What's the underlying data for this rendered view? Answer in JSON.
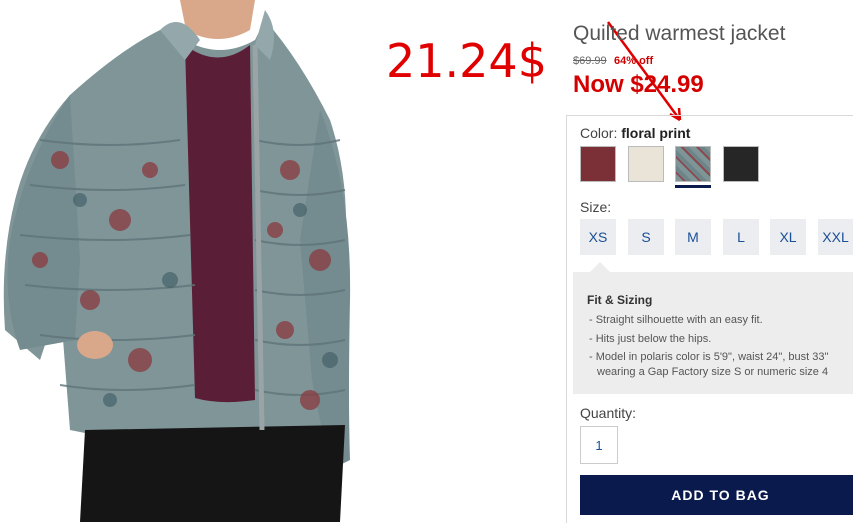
{
  "annotation": {
    "price_text": "21.24$",
    "color": "#e00000"
  },
  "product": {
    "title": "Quilted warmest jacket",
    "original_price": "$69.99",
    "discount": "64% off",
    "now_price": "Now $24.99"
  },
  "color": {
    "label": "Color:",
    "selected": "floral print",
    "swatches": [
      {
        "name": "burgundy",
        "hex": "#7a3036"
      },
      {
        "name": "cream",
        "hex": "#e9e3d8"
      },
      {
        "name": "floral print",
        "hex": "#7e9597"
      },
      {
        "name": "black",
        "hex": "#262626"
      }
    ]
  },
  "size": {
    "label": "Size:",
    "options": [
      "XS",
      "S",
      "M",
      "L",
      "XL",
      "XXL"
    ]
  },
  "fit": {
    "title": "Fit & Sizing",
    "lines": [
      "- Straight silhouette with an easy fit.",
      "- Hits just below the hips.",
      "- Model in polaris color is 5'9\", waist 24\", bust 33\"",
      "  wearing a Gap Factory size S or numeric size 4"
    ]
  },
  "quantity": {
    "label": "Quantity:",
    "value": "1"
  },
  "cart": {
    "button_label": "ADD TO BAG"
  },
  "colors": {
    "sale_red": "#d40000",
    "navy": "#0b1a4d",
    "link_blue": "#1b4f96"
  }
}
